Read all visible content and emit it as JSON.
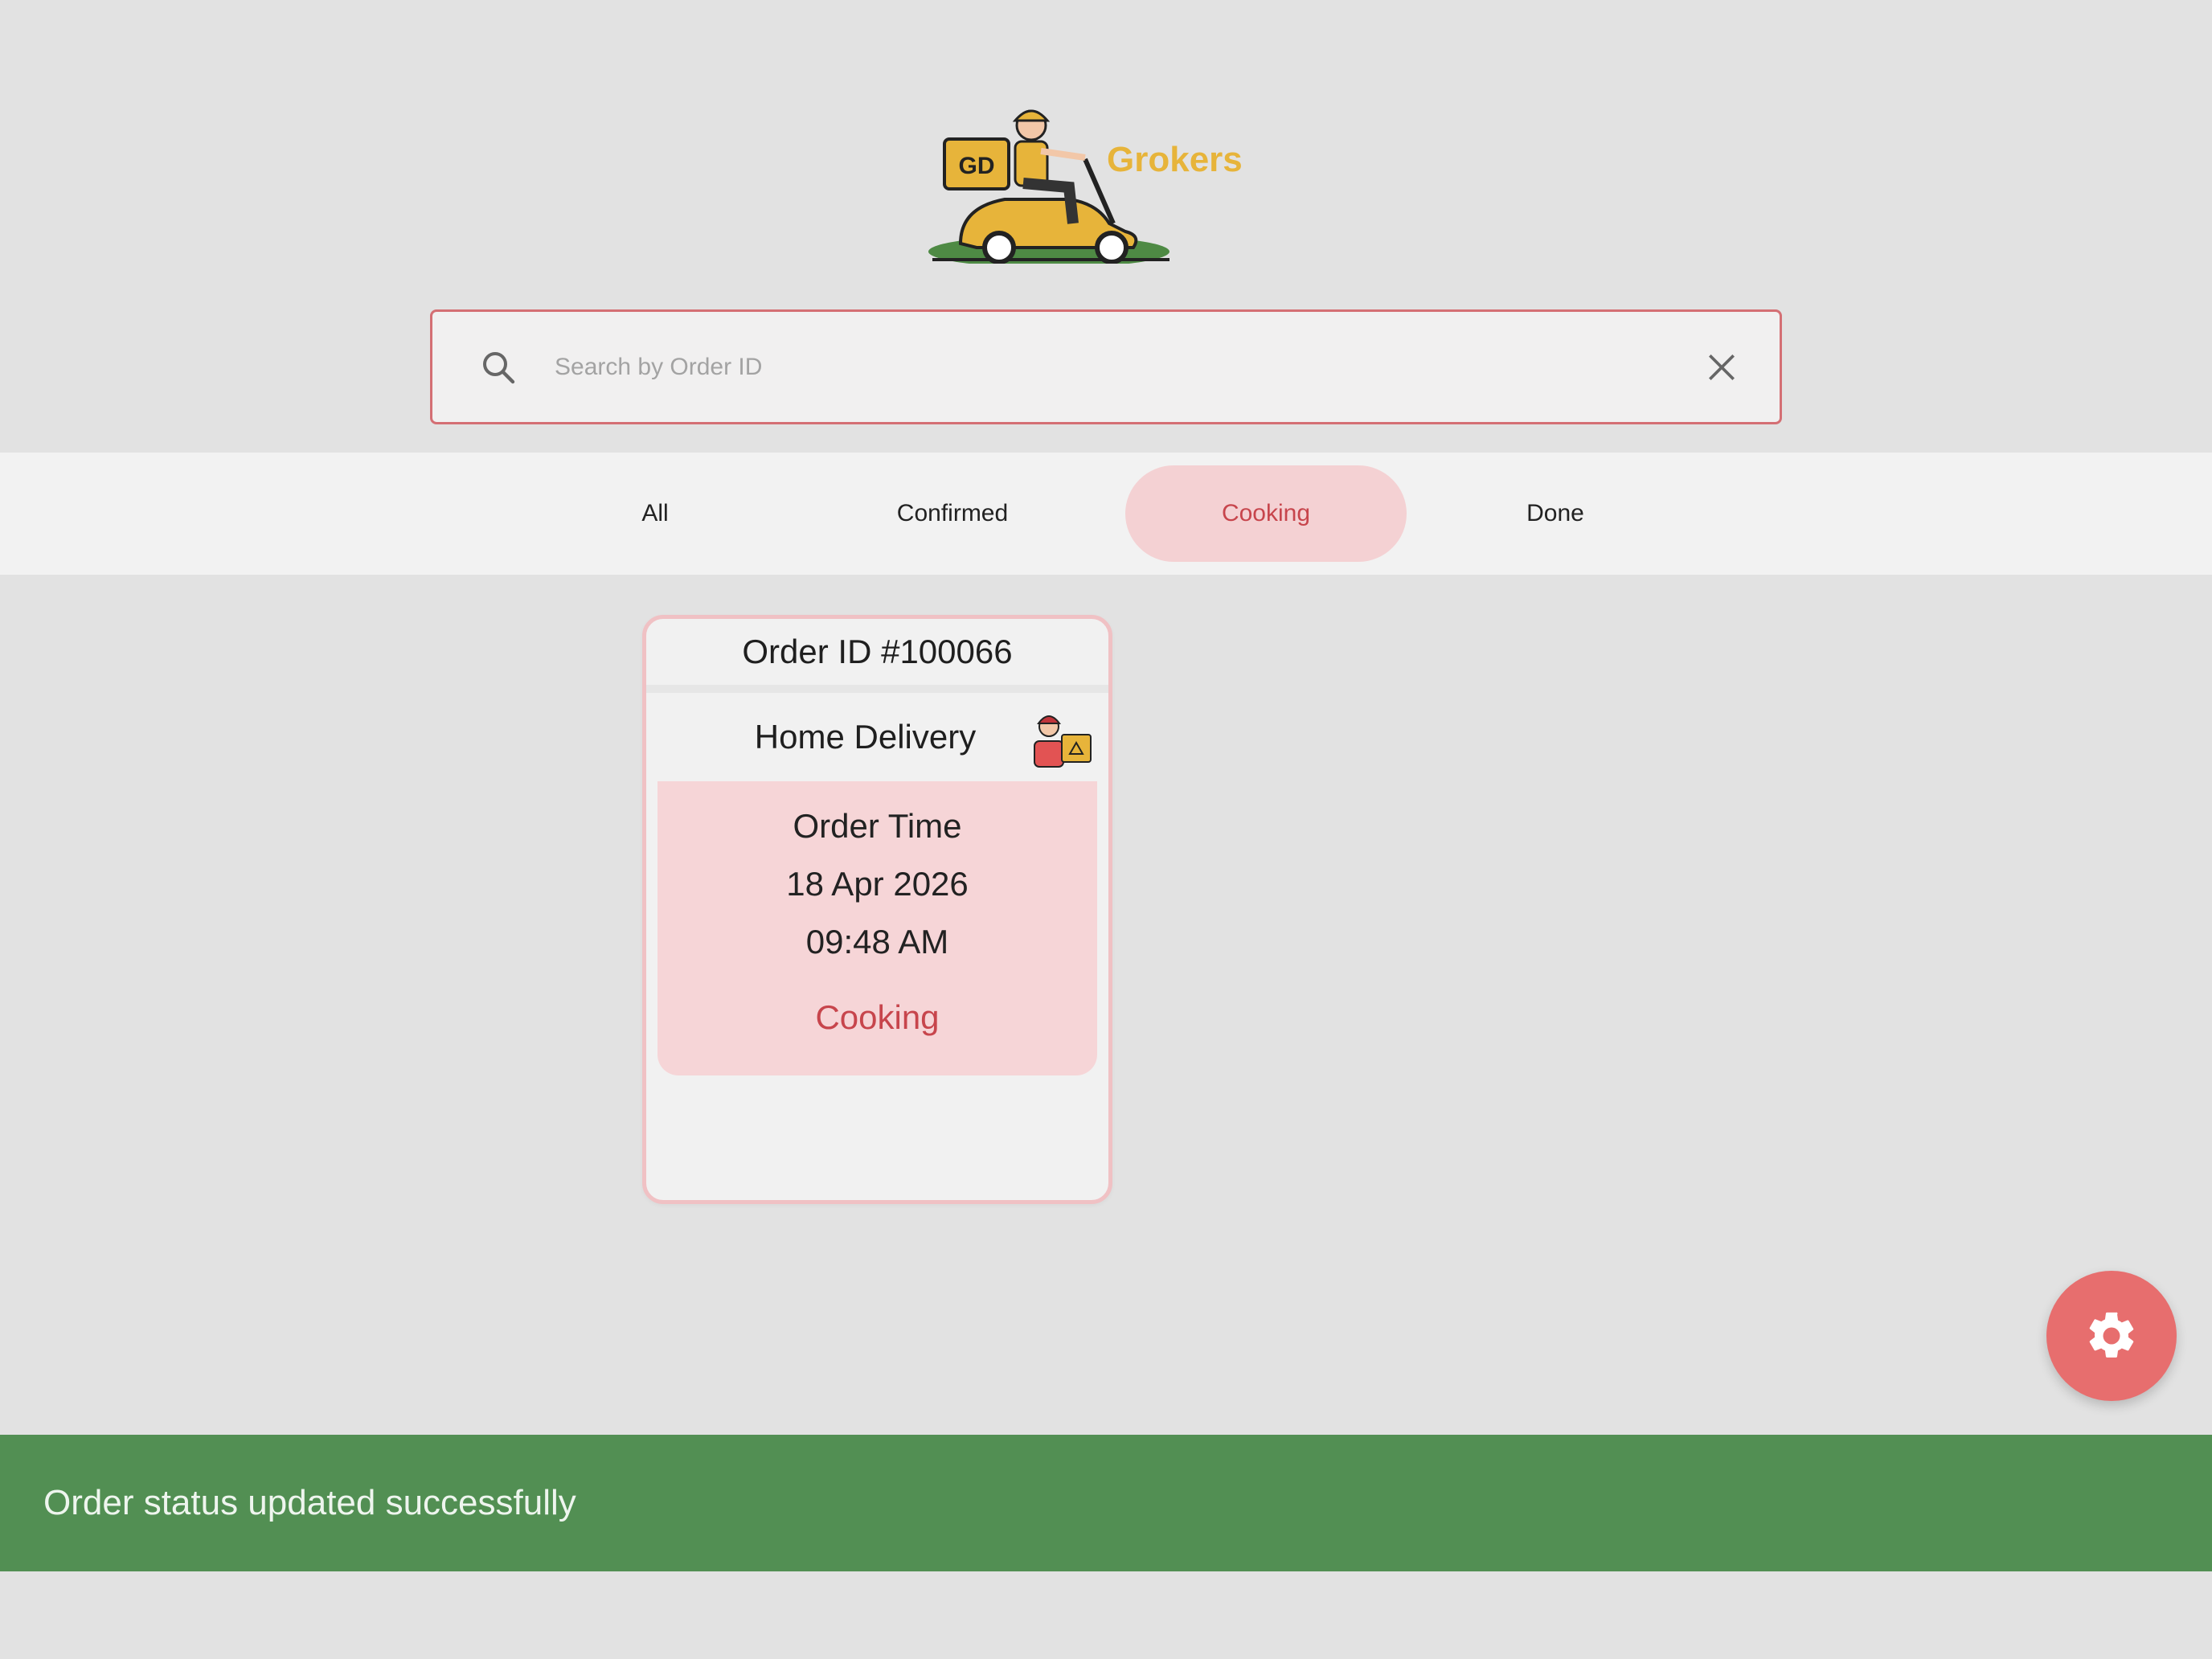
{
  "brand": {
    "badge": "GD",
    "name": "Grokers",
    "logo_color": "#e7b43a"
  },
  "search": {
    "placeholder": "Search by Order ID",
    "value": ""
  },
  "tabs": [
    {
      "label": "All",
      "active": false
    },
    {
      "label": "Confirmed",
      "active": false
    },
    {
      "label": "Cooking",
      "active": true
    },
    {
      "label": "Done",
      "active": false
    }
  ],
  "order": {
    "id_label": "Order ID #100066",
    "type": "Home Delivery",
    "time_heading": "Order Time",
    "date": "18 Apr 2026",
    "time": "09:48 AM",
    "status": "Cooking"
  },
  "fab": {
    "icon": "gear-icon"
  },
  "snackbar": {
    "message": "Order status updated successfully",
    "color": "#528f53"
  },
  "colors": {
    "accent": "#c7454c",
    "active_tab_bg": "#f4d1d3",
    "fab": "#e76e6e"
  }
}
